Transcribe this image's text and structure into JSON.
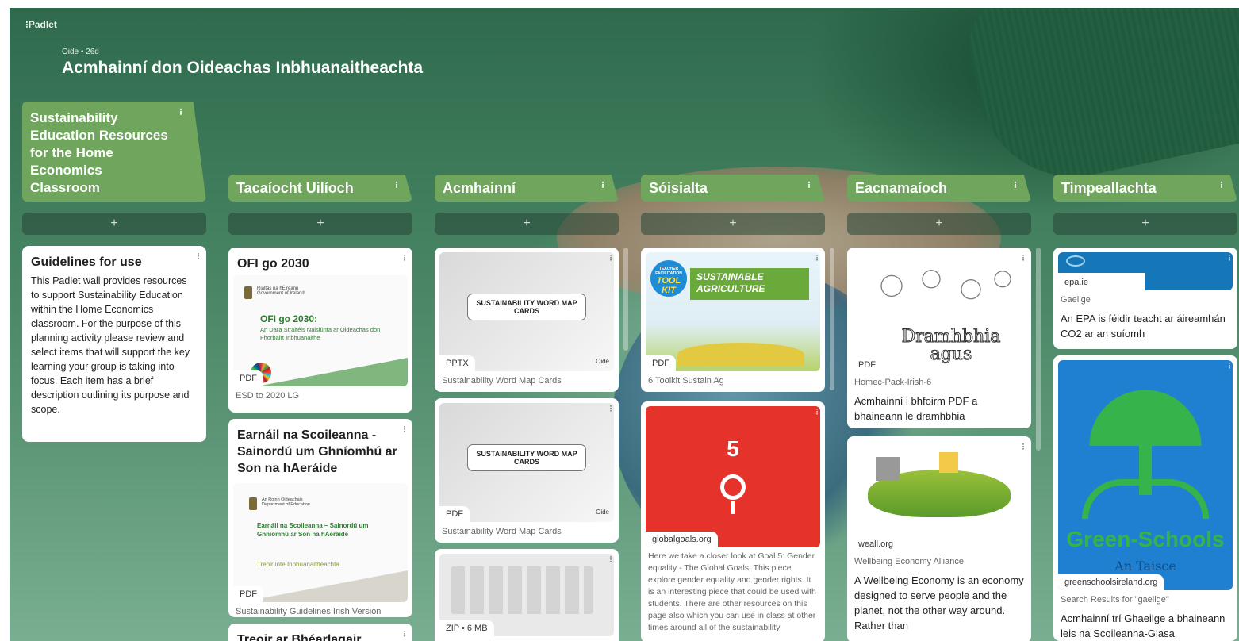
{
  "app": {
    "brand": "⁝Padlet"
  },
  "board": {
    "meta": "Oide • 26d",
    "title": "Acmhainní don Oideachas Inbhuanaitheachta"
  },
  "add_label": "+",
  "menu_glyph": "⁝",
  "columns": [
    {
      "title": "Sustainability Education Resources for the Home Economics Classroom"
    },
    {
      "title": "Tacaíocht Uilíoch"
    },
    {
      "title": "Acmhainní"
    },
    {
      "title": "Sóisialta"
    },
    {
      "title": "Eacnamaíoch"
    },
    {
      "title": "Timpeallachta"
    }
  ],
  "posts": {
    "guidelines": {
      "title": "Guidelines for use",
      "body": "This Padlet wall provides resources to support Sustainability Education within the Home Economics classroom. For the purpose of this planning activity please review and select items that will support the key learning your group is taking into focus. Each item has a brief description outlining its purpose and scope."
    },
    "ofi": {
      "title": "OFI go 2030",
      "doc_org": "Rialtas na hÉireann\nGovernment of Ireland",
      "doc_title": "OFI go 2030:",
      "doc_sub": "An Dara Straitéis Náisiúnta ar Oideachas don Fhorbairt Inbhuanaithe",
      "tag": "PDF",
      "caption": "ESD to 2020 LG"
    },
    "earnail": {
      "title": "Earnáil na Scoileanna - Sainordú um Ghníomhú ar Son na hAeráide",
      "doc_org": "An Roinn Oideachais\nDepartment of Education",
      "doc_title": "Earnáil na Scoileanna – Sainordú um Ghníomhú ar Son na hAeráide",
      "doc_sub": "Treoirlínte Inbhuanaitheachta",
      "tag": "PDF",
      "caption": "Sustainability Guidelines Irish Version"
    },
    "treoir": {
      "title": "Treoir ar Bhéarlagair"
    },
    "wordmap1": {
      "card_text": "SUSTAINABILITY WORD MAP CARDS",
      "tag": "PPTX",
      "mark": "Oide",
      "caption": "Sustainability Word Map Cards"
    },
    "wordmap2": {
      "card_text": "SUSTAINABILITY WORD MAP CARDS",
      "tag": "PDF",
      "mark": "Oide",
      "caption": "Sustainability Word Map Cards"
    },
    "zip": {
      "tag": "ZIP • 6 MB"
    },
    "toolkit": {
      "badge_top": "TEACHER FACILITATION",
      "badge_main": "TOOL KIT",
      "banner": "SUSTAINABLE AGRICULTURE",
      "tag": "PDF",
      "caption": "6 Toolkit Sustain Ag"
    },
    "goal5": {
      "number": "5",
      "tag": "globalgoals.org",
      "desc": "Here we take a closer look at Goal 5: Gender equality - The Global Goals. This piece explore gender equality and gender rights. It is an interesting piece that could be used with students. There are other resources on this page also which you can use in class at other times around all of the sustainability"
    },
    "dramhbhia": {
      "art_text": "Dramhbhia agus",
      "tag": "PDF",
      "caption": "Homec-Pack-Irish-6",
      "desc": "Acmhainní i bhfoirm PDF a bhaineann le dramhbhia"
    },
    "weall": {
      "tag": "weall.org",
      "caption": "Wellbeing Economy Alliance",
      "desc": "A Wellbeing Economy is an economy designed to serve people and the planet, not the other way around. Rather than"
    },
    "epa": {
      "tag": "epa.ie",
      "caption": "Gaeilge",
      "desc": "An EPA is féidir teacht ar áireamhán CO2 ar an suíomh"
    },
    "greenschools": {
      "logo_text": "Green-Schools",
      "sub_text": "An Taisce",
      "tag": "greenschoolsireland.org",
      "caption": "Search Results for \"gaeilge\"",
      "desc": "Acmhainní trí Ghaeilge a bhaineann leis na Scoileanna-Glasa"
    }
  },
  "colors": {
    "header_green": "#6fa55d",
    "bg_green": "#3f7d5c",
    "goal5_red": "#e5322a",
    "greenschools_blue": "#1f7fd0"
  }
}
